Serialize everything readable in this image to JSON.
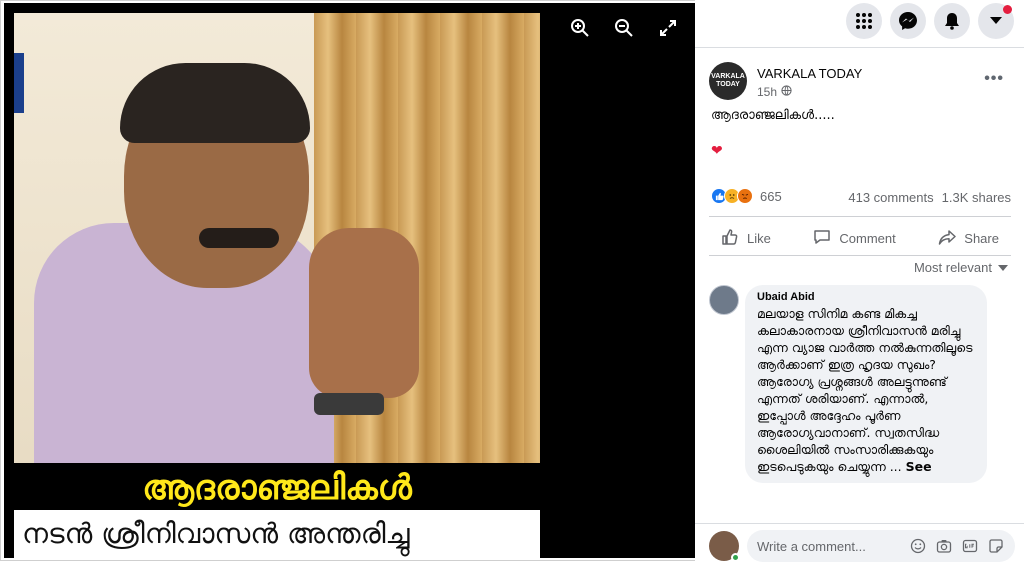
{
  "viewer": {
    "caption_line1": "ആദരാഞ്ജലികൾ",
    "caption_line2": "നടൻ ശ്രീനിവാസൻ അന്തരിച്ചു",
    "zoom_in_icon": "zoom-in-icon",
    "zoom_out_icon": "zoom-out-icon",
    "fullscreen_icon": "fullscreen-icon"
  },
  "nav": {
    "menu_icon": "grid-menu-icon",
    "messenger_icon": "messenger-icon",
    "notifications_icon": "bell-icon",
    "account_icon": "caret-down-icon",
    "notification_dot_color": "#e41e3f"
  },
  "post": {
    "page_avatar_text": "VARKALA TODAY",
    "page_name": "VARKALA TODAY",
    "time": "15h",
    "text": "ആദരാഞ്ജലികൾ.....",
    "heart": "❤",
    "reaction_count": "665",
    "comments": "413 comments",
    "shares": "1.3K shares",
    "actions": {
      "like": "Like",
      "comment": "Comment",
      "share": "Share"
    },
    "sort_label": "Most relevant"
  },
  "comment": {
    "author": "Ubaid Abid",
    "text": "മലയാള സിനിമ കണ്ട മികച്ച കലാകാരനായ ശ്രീനിവാസൻ മരിച്ചു എന്ന വ്യാജ വാർത്ത നൽകുന്നതിലൂടെ ആർക്കാണ് ഇത്ര ഹൃദയ സുഖം? ആരോഗ്യ പ്രശ്നങ്ങൾ അലട്ടുന്നുണ്ട് എന്നത് ശരിയാണ്. എന്നാൽ, ഇപ്പോൾ അദ്ദേഹം പൂർണ ആരോഗ്യവാനാണ്. സ്വതസിദ്ധ ശൈലിയിൽ സംസാരിക്കുകയും ഇടപെടുകയും ചെയ്യുന്ന ...",
    "see_more": "See"
  },
  "composer": {
    "placeholder": "Write a comment..."
  },
  "colors": {
    "brand": "#1877f2",
    "caption_yellow": "#ffe81a"
  }
}
